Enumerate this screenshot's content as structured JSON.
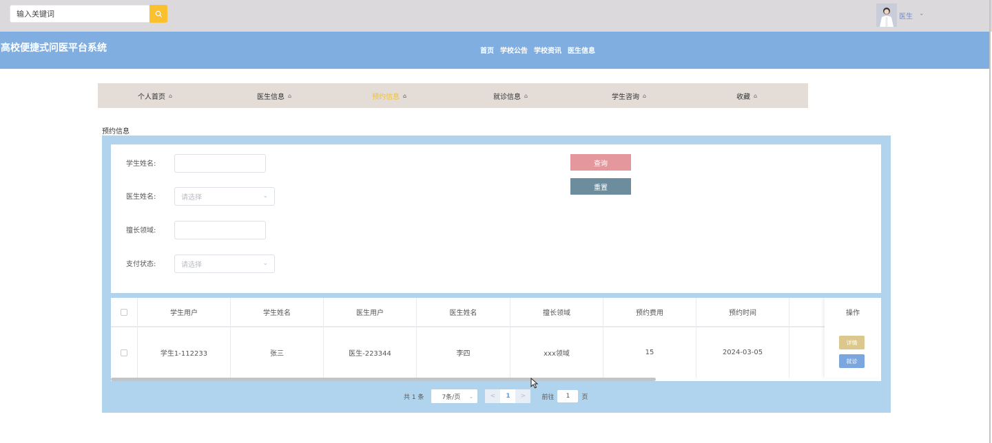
{
  "search": {
    "placeholder": "输入关键词"
  },
  "user": {
    "name": "医生"
  },
  "header": {
    "site_title": "高校便捷式问医平台系统",
    "nav": [
      "首页",
      "学校公告",
      "学校资讯",
      "医生信息"
    ]
  },
  "subnav": [
    {
      "label": "个人首页",
      "active": false
    },
    {
      "label": "医生信息",
      "active": false
    },
    {
      "label": "预约信息",
      "active": true
    },
    {
      "label": "就诊信息",
      "active": false
    },
    {
      "label": "学生咨询",
      "active": false
    },
    {
      "label": "收藏",
      "active": false
    }
  ],
  "section_label": "预约信息",
  "filters": {
    "student_name_label": "学生姓名:",
    "doctor_name_label": "医生姓名:",
    "doctor_name_placeholder": "请选择",
    "specialty_label": "擅长领域:",
    "pay_status_label": "支付状态:",
    "pay_status_placeholder": "请选择",
    "query_label": "查询",
    "reset_label": "重置"
  },
  "table": {
    "columns": [
      "学生用户",
      "学生姓名",
      "医生用户",
      "医生姓名",
      "擅长领域",
      "预约费用",
      "预约时间"
    ],
    "ops_header": "操作",
    "rows": [
      [
        "学生1-112233",
        "张三",
        "医生-223344",
        "李四",
        "xxx领域",
        "15",
        "2024-03-05"
      ]
    ],
    "detail_label": "详情",
    "visit_label": "就诊"
  },
  "pagination": {
    "total_text": "共 1 条",
    "page_size": "7条/页",
    "current_page": "1",
    "goto_prefix": "前往",
    "goto_value": "1",
    "goto_suffix": "页"
  },
  "colors": {
    "header_bg": "#80aee1",
    "subnav_active": "#f0c232",
    "query_button": "#e4989e",
    "reset_button": "#6c8d9d",
    "detail_button": "#dcc78d",
    "visit_button": "#7ba6de"
  }
}
